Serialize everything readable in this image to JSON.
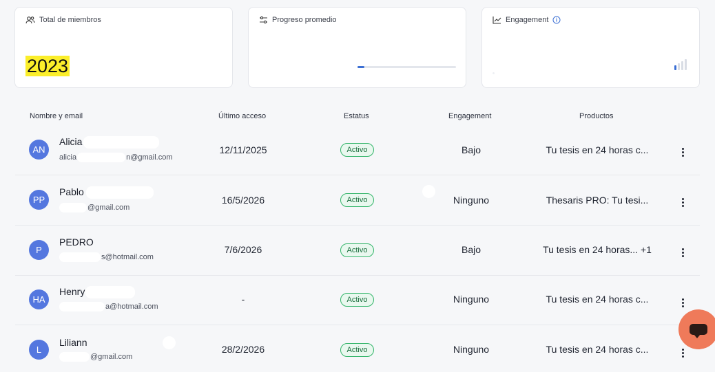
{
  "stats": {
    "members": {
      "label": "Total de miembros",
      "value": "2023",
      "icon": "users-icon"
    },
    "progress": {
      "label": "Progreso promedio",
      "value_fraction": 0.07,
      "icon": "sliders-icon"
    },
    "engagement": {
      "label": "Engagement",
      "icon": "trend-chart-icon",
      "info_icon": "info-icon",
      "level": 1,
      "max_level": 4
    }
  },
  "table": {
    "headers": {
      "name": "Nombre y email",
      "last_access": "Último acceso",
      "status": "Estatus",
      "engagement": "Engagement",
      "products": "Productos"
    },
    "rows": [
      {
        "initials": "AN",
        "name": "Alicia",
        "email_prefix": "alicia",
        "email_suffix": "n@gmail.com",
        "last_access": "12/11/2025",
        "status": "Activo",
        "engagement": "Bajo",
        "products": "Tu tesis en 24 horas c..."
      },
      {
        "initials": "PP",
        "name": "Pablo",
        "email_prefix": "",
        "email_suffix": "@gmail.com",
        "last_access": "16/5/2026",
        "status": "Activo",
        "engagement": "Ninguno",
        "products": "Thesaris PRO: Tu tesi..."
      },
      {
        "initials": "P",
        "name": "PEDRO",
        "email_prefix": "",
        "email_suffix": "s@hotmail.com",
        "last_access": "7/6/2026",
        "status": "Activo",
        "engagement": "Bajo",
        "products": "Tu tesis en 24 horas... +1"
      },
      {
        "initials": "HA",
        "name": "Henry",
        "email_prefix": "",
        "email_suffix": "a@hotmail.com",
        "last_access": "-",
        "status": "Activo",
        "engagement": "Ninguno",
        "products": "Tu tesis en 24 horas c..."
      },
      {
        "initials": "L",
        "name": "Liliann",
        "email_prefix": "",
        "email_suffix": "@gmail.com",
        "last_access": "28/2/2026",
        "status": "Activo",
        "engagement": "Ninguno",
        "products": "Tu tesis en 24 horas c..."
      }
    ]
  },
  "colors": {
    "accent": "#3b6fd4",
    "avatar": "#5477df",
    "status_green": "#33b56a",
    "highlight": "#fbee2a",
    "chat_fab": "#ef7a5a"
  }
}
